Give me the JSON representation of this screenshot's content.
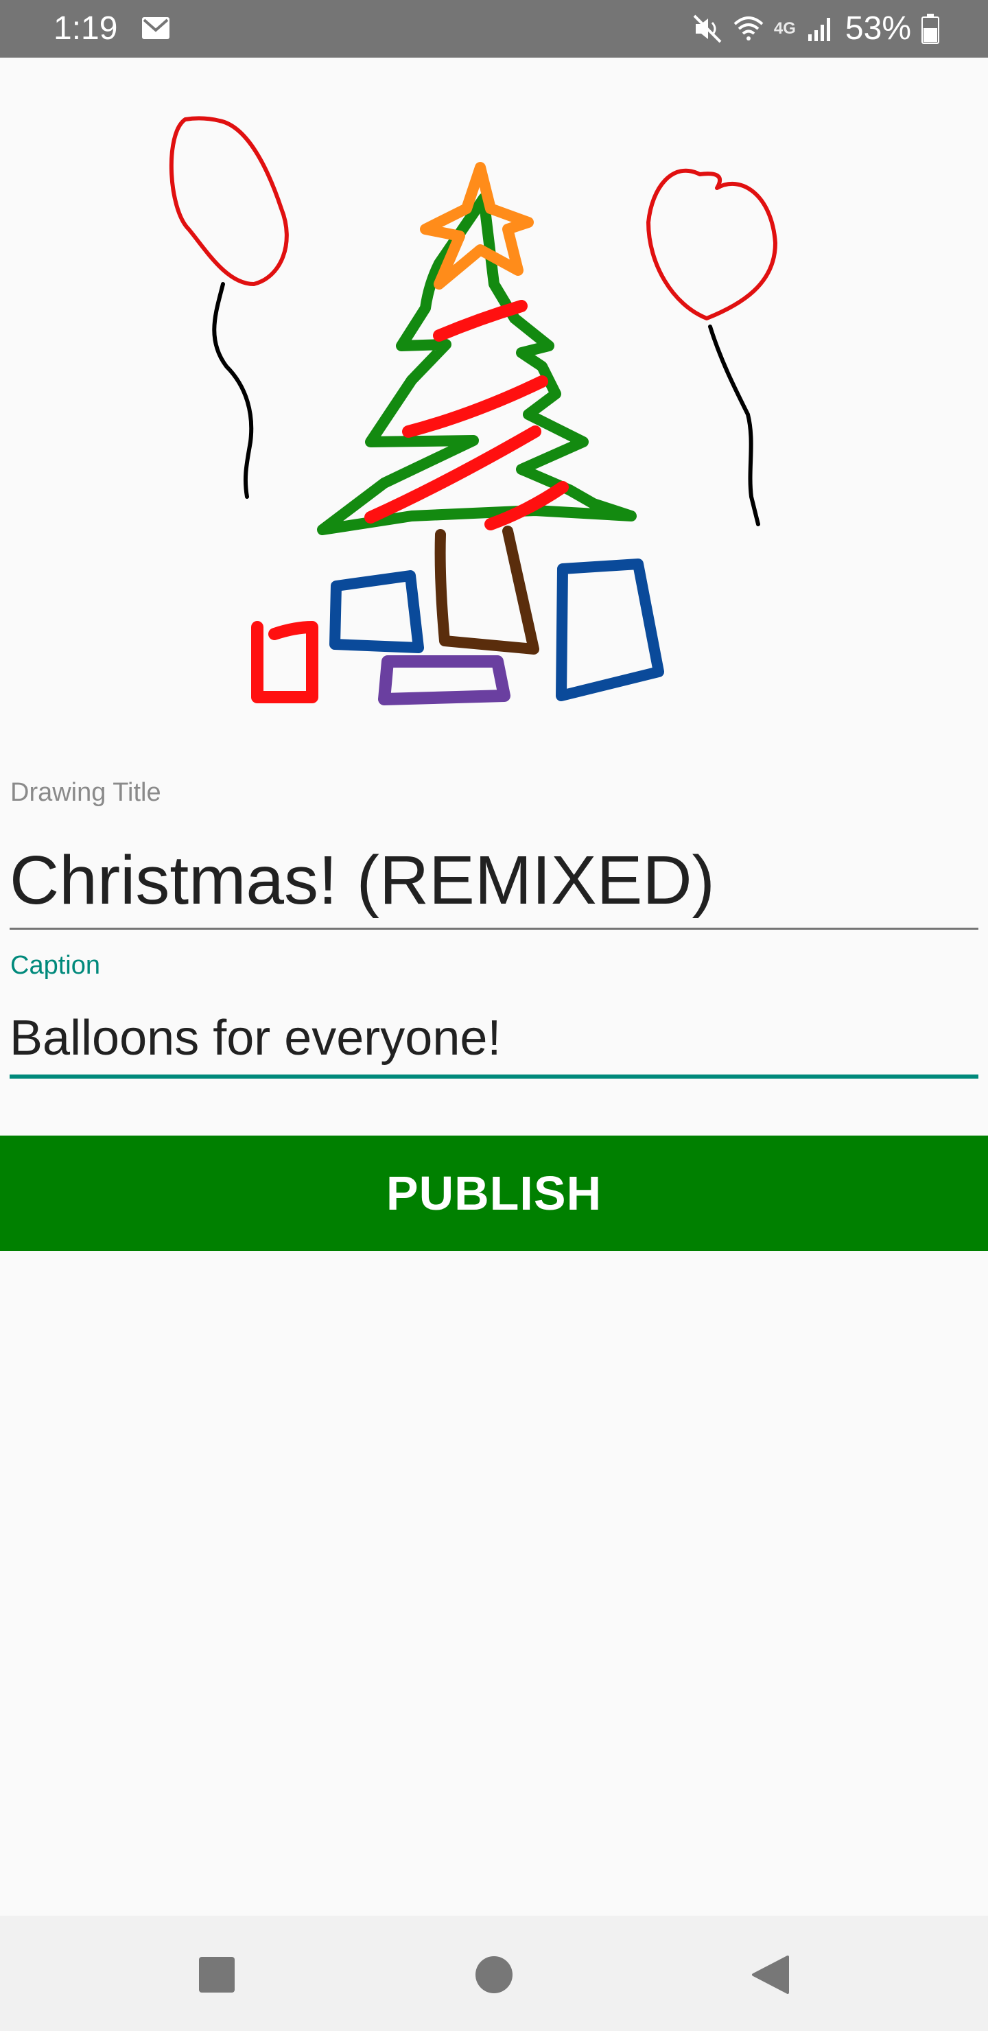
{
  "status_bar": {
    "time": "1:19",
    "battery": "53%",
    "network": "4G",
    "icons": [
      "gmail-icon",
      "mute-icon",
      "wifi-icon",
      "signal-icon",
      "battery-icon"
    ]
  },
  "drawing": {
    "strokes_colors": {
      "green": "#008000",
      "red": "#ff0000",
      "orange": "#ff8c00",
      "brown": "#5a2d0c",
      "blue": "#0a4a9a",
      "purple": "#6a3fa0",
      "black": "#000000"
    }
  },
  "form": {
    "title_label": "Drawing Title",
    "title_value": "Christmas! (REMIXED)",
    "caption_label": "Caption",
    "caption_value": "Balloons for everyone!"
  },
  "actions": {
    "publish_label": "PUBLISH"
  },
  "colors": {
    "accent": "#00897b",
    "publish_bg": "#008000",
    "status_bar": "#757575"
  },
  "nav": {
    "items": [
      "recents-icon",
      "home-icon",
      "back-icon"
    ]
  }
}
